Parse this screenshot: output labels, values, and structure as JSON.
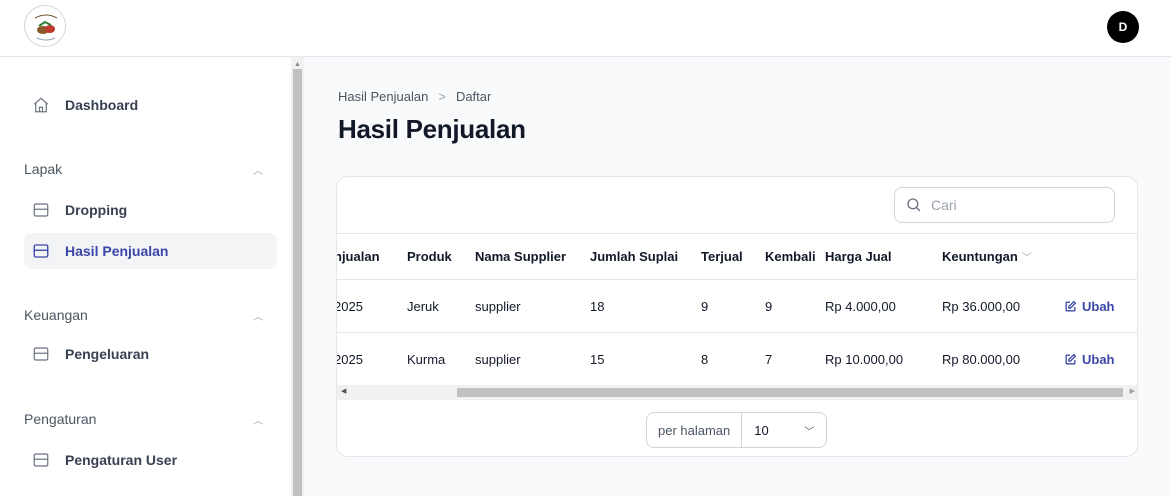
{
  "header": {
    "avatar_initial": "D"
  },
  "sidebar": {
    "dashboard": "Dashboard",
    "groups": [
      {
        "label": "Lapak",
        "items": [
          "Dropping",
          "Hasil Penjualan"
        ]
      },
      {
        "label": "Keuangan",
        "items": [
          "Pengeluaran"
        ]
      },
      {
        "label": "Pengaturan",
        "items": [
          "Pengaturan User"
        ]
      }
    ],
    "active_item": "Hasil Penjualan"
  },
  "breadcrumb": {
    "parent": "Hasil Penjualan",
    "separator": ">",
    "current": "Daftar"
  },
  "page": {
    "title": "Hasil Penjualan"
  },
  "search": {
    "placeholder": "Cari"
  },
  "table": {
    "columns": [
      "njualan",
      "Produk",
      "Nama Supplier",
      "Jumlah Suplai",
      "Terjual",
      "Kembali",
      "Harga Jual",
      "Keuntungan"
    ],
    "rows": [
      {
        "tanggal": "2025",
        "produk": "Jeruk",
        "supplier": "supplier",
        "jumlah": "18",
        "terjual": "9",
        "kembali": "9",
        "harga": "Rp 4.000,00",
        "keuntungan": "Rp 36.000,00",
        "action": "Ubah"
      },
      {
        "tanggal": "2025",
        "produk": "Kurma",
        "supplier": "supplier",
        "jumlah": "15",
        "terjual": "8",
        "kembali": "7",
        "harga": "Rp 10.000,00",
        "keuntungan": "Rp 80.000,00",
        "action": "Ubah"
      }
    ]
  },
  "pagination": {
    "label": "per halaman",
    "value": "10"
  },
  "colors": {
    "accent": "#3b47a8",
    "active_bg": "#f3f4f6"
  }
}
